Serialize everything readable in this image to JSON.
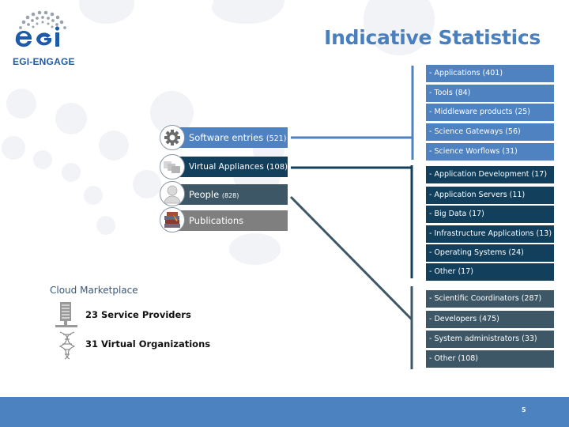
{
  "slide": {
    "title": "Indicative Statistics",
    "page_number": "5"
  },
  "logo": {
    "brand": "egi",
    "subtitle": "EGI-ENGAGE"
  },
  "categories": [
    {
      "label": "Software entries",
      "count": "(521)",
      "icon": "gear-icon",
      "color": "#4e82c0"
    },
    {
      "label": "Virtual Appliances",
      "count": "(108)",
      "icon": "virtual-appliance-icon",
      "color": "#123f5c"
    },
    {
      "label": "People",
      "count": "(828)",
      "icon": "person-icon",
      "color": "#3d5766"
    },
    {
      "label": "Publications",
      "count": "",
      "icon": "books-icon",
      "color": "#7f7f7f"
    }
  ],
  "software_breakdown": [
    "- Applications (401)",
    "- Tools (84)",
    "- Middleware products (25)",
    "- Science Gateways (56)",
    "- Science Worflows (31)"
  ],
  "virtual_appliance_breakdown": [
    "- Application Development (17)",
    "- Application Servers (11)",
    "- Big Data (17)",
    "- Infrastructure Applications (13)",
    "- Operating Systems (24)",
    "- Other (17)"
  ],
  "people_breakdown": [
    "- Scientific Coordinators (287)",
    "- Developers (475)",
    "- System administrators (33)",
    "- Other (108)"
  ],
  "cloud_marketplace": {
    "title": "Cloud Marketplace",
    "items": [
      {
        "text": "23 Service Providers",
        "icon": "server-icon"
      },
      {
        "text": "31 Virtual Organizations",
        "icon": "dna-icon"
      }
    ]
  }
}
